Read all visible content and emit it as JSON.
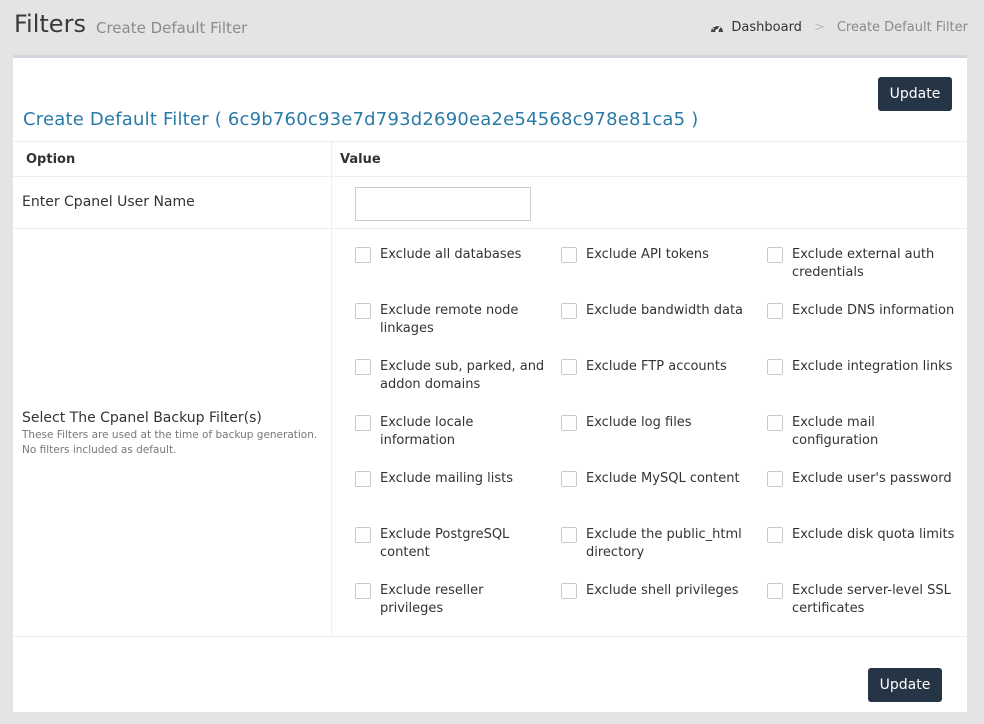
{
  "header": {
    "title": "Filters",
    "subtitle": "Create Default Filter"
  },
  "breadcrumb": {
    "home_icon": "dashboard-icon",
    "home_label": "Dashboard",
    "separator": ">",
    "current": "Create Default Filter"
  },
  "box": {
    "title": "Create Default Filter ( 6c9b760c93e7d793d2690ea2e54568c978e81ca5 )",
    "update_label_top": "Update",
    "update_label_bottom": "Update"
  },
  "table": {
    "col_option": "Option",
    "col_value": "Value",
    "username_label": "Enter Cpanel User Name",
    "username_value": "",
    "filters_label": "Select The Cpanel Backup Filter(s)",
    "filters_help_1": "These Filters are used at the time of backup generation.",
    "filters_help_2": "No filters included as default."
  },
  "filters": [
    {
      "label": "Exclude all databases",
      "checked": false
    },
    {
      "label": "Exclude API tokens",
      "checked": false
    },
    {
      "label": "Exclude external auth credentials",
      "checked": false
    },
    {
      "label": "Exclude remote node linkages",
      "checked": false
    },
    {
      "label": "Exclude bandwidth data",
      "checked": false
    },
    {
      "label": "Exclude DNS information",
      "checked": false
    },
    {
      "label": "Exclude sub, parked, and addon domains",
      "checked": false
    },
    {
      "label": "Exclude FTP accounts",
      "checked": false
    },
    {
      "label": "Exclude integration links",
      "checked": false
    },
    {
      "label": "Exclude locale information",
      "checked": false
    },
    {
      "label": "Exclude log files",
      "checked": false
    },
    {
      "label": "Exclude mail configuration",
      "checked": false
    },
    {
      "label": "Exclude mailing lists",
      "checked": false
    },
    {
      "label": "Exclude MySQL content",
      "checked": false
    },
    {
      "label": "Exclude user's password",
      "checked": false
    },
    {
      "label": "Exclude PostgreSQL content",
      "checked": false
    },
    {
      "label": "Exclude the public_html directory",
      "checked": false
    },
    {
      "label": "Exclude disk quota limits",
      "checked": false
    },
    {
      "label": "Exclude reseller privileges",
      "checked": false
    },
    {
      "label": "Exclude shell privileges",
      "checked": false
    },
    {
      "label": "Exclude server-level SSL certificates",
      "checked": false
    }
  ],
  "colors": {
    "accent_button": "#263545",
    "title_link": "#2a7aa8"
  }
}
